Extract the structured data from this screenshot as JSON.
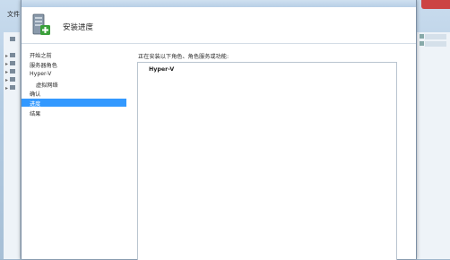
{
  "background_app": {
    "menu_label": "文件"
  },
  "wizard": {
    "title": "安装进度",
    "nav": [
      {
        "label": "开始之前",
        "indent": false,
        "active": false
      },
      {
        "label": "服务器角色",
        "indent": false,
        "active": false
      },
      {
        "label": "Hyper-V",
        "indent": false,
        "active": false
      },
      {
        "label": "虚拟网络",
        "indent": true,
        "active": false
      },
      {
        "label": "确认",
        "indent": false,
        "active": false
      },
      {
        "label": "进度",
        "indent": false,
        "active": true
      },
      {
        "label": "结果",
        "indent": false,
        "active": false
      }
    ],
    "progress_description": "正在安装以下角色、角色服务或功能:",
    "installing_items": [
      "Hyper-V"
    ]
  },
  "colors": {
    "nav_active": "#3399ff",
    "icon_badge": "#3aa03a"
  }
}
